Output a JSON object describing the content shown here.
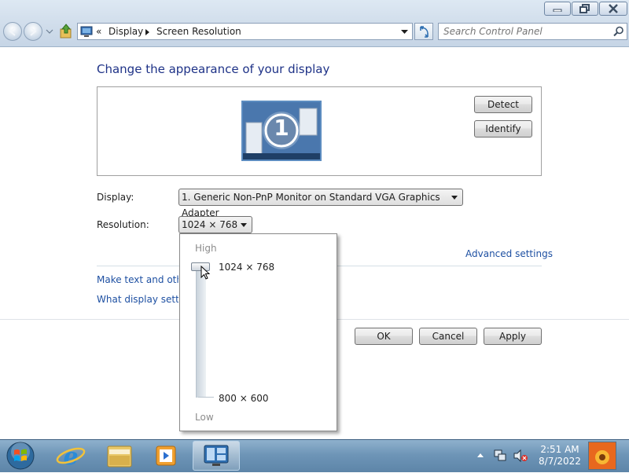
{
  "window": {
    "breadcrumb_sep": "«",
    "breadcrumb": [
      "Display",
      "Screen Resolution"
    ],
    "search_placeholder": "Search Control Panel"
  },
  "main": {
    "title": "Change the appearance of your display",
    "monitor_number": "1",
    "detect_label": "Detect",
    "identify_label": "Identify",
    "display_label": "Display:",
    "display_value": "1. Generic Non-PnP Monitor on Standard VGA Graphics Adapter",
    "resolution_label": "Resolution:",
    "resolution_value": "1024 × 768",
    "advanced_link": "Advanced settings",
    "link_make_text": "Make text and other",
    "link_what_display": "What display setting",
    "ok_label": "OK",
    "cancel_label": "Cancel",
    "apply_label": "Apply"
  },
  "resolution_popup": {
    "high_label": "High",
    "low_label": "Low",
    "top_value": "1024 × 768",
    "bottom_value": "800 × 600",
    "slider_position": "top"
  },
  "taskbar": {
    "time": "2:51 AM",
    "date": "8/7/2022",
    "apps": [
      "start-orb",
      "internet-explorer",
      "windows-explorer",
      "media-player",
      "control-panel-display"
    ]
  }
}
